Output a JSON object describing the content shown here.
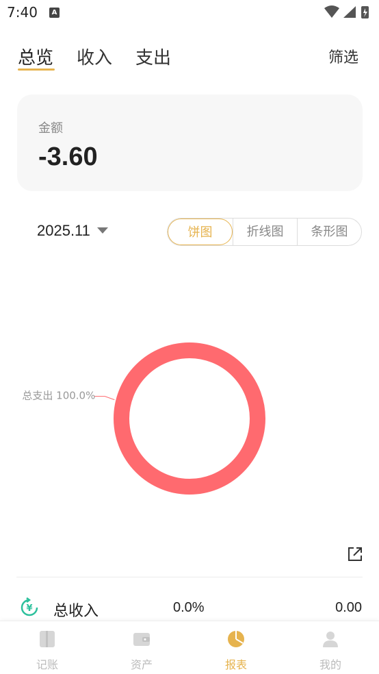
{
  "status_bar": {
    "time": "7:40",
    "badge": "A"
  },
  "tabs": [
    {
      "label": "总览",
      "active": true
    },
    {
      "label": "收入",
      "active": false
    },
    {
      "label": "支出",
      "active": false
    }
  ],
  "filter_label": "筛选",
  "amount_card": {
    "label": "金额",
    "value": "-3.60"
  },
  "month": "2025.11",
  "chart_types": [
    {
      "label": "饼图",
      "active": true
    },
    {
      "label": "折线图",
      "active": false
    },
    {
      "label": "条形图",
      "active": false
    }
  ],
  "chart_data": {
    "type": "pie",
    "style": "donut",
    "slices": [
      {
        "label": "总支出",
        "value": 100.0,
        "percent_label": "100.0%",
        "color": "#ff6a6f"
      }
    ]
  },
  "income_row": {
    "label": "总收入",
    "percent": "0.0%",
    "amount": "0.00"
  },
  "bottom_nav": [
    {
      "label": "记账",
      "icon": "book-icon",
      "active": false
    },
    {
      "label": "资产",
      "icon": "wallet-icon",
      "active": false
    },
    {
      "label": "报表",
      "icon": "pie-chart-icon",
      "active": true
    },
    {
      "label": "我的",
      "icon": "user-icon",
      "active": false
    }
  ],
  "colors": {
    "accent": "#e6b34e",
    "expense": "#ff6a6f",
    "income_icon": "#2cc09c"
  }
}
